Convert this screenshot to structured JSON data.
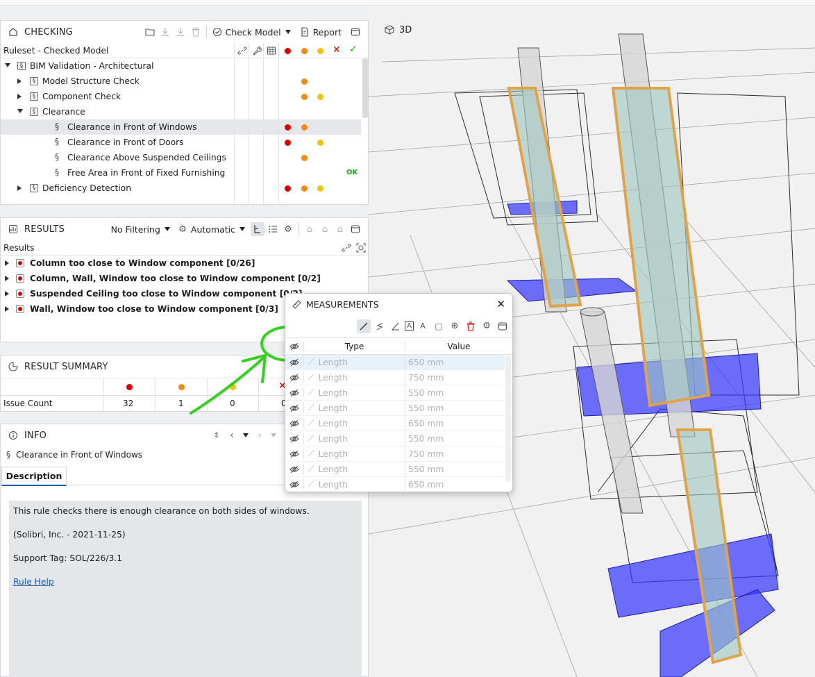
{
  "checking": {
    "title": "CHECKING",
    "check_model": "Check Model",
    "report": "Report",
    "column": "Ruleset - Checked Model",
    "rows": [
      {
        "label": "BIM Validation - Architectural",
        "level": 0,
        "expand": "open",
        "sym": "box",
        "dots": [],
        "ok": ""
      },
      {
        "label": "Model Structure Check",
        "level": 1,
        "expand": "closed",
        "sym": "box",
        "dots": [
          "org"
        ],
        "ok": ""
      },
      {
        "label": "Component Check",
        "level": 1,
        "expand": "closed",
        "sym": "box",
        "dots": [
          "org",
          "yel"
        ],
        "ok": ""
      },
      {
        "label": "Clearance",
        "level": 1,
        "expand": "open",
        "sym": "box",
        "dots": [],
        "ok": ""
      },
      {
        "label": "Clearance in Front of Windows",
        "level": 2,
        "expand": "",
        "sym": "§",
        "dots": [
          "red",
          "org"
        ],
        "ok": "",
        "selected": true
      },
      {
        "label": "Clearance in Front of Doors",
        "level": 2,
        "expand": "",
        "sym": "§",
        "dots": [
          "red",
          "yel"
        ],
        "ok": ""
      },
      {
        "label": "Clearance Above Suspended Ceilings",
        "level": 2,
        "expand": "",
        "sym": "§",
        "dots": [
          "org"
        ],
        "ok": ""
      },
      {
        "label": "Free Area in Front of Fixed Furnishing",
        "level": 2,
        "expand": "",
        "sym": "§",
        "dots": [],
        "ok": "OK"
      },
      {
        "label": "Deficiency Detection",
        "level": 1,
        "expand": "closed",
        "sym": "box",
        "dots": [
          "red",
          "org",
          "yel"
        ],
        "ok": ""
      }
    ]
  },
  "results": {
    "title": "RESULTS",
    "filter": "No Filtering",
    "mode": "Automatic",
    "column": "Results",
    "rows": [
      "Column too close to Window component [0/26]",
      "Column, Wall, Window too close to Window component [0/2]",
      "Suspended Ceiling too close to Window component [0/2]",
      "Wall, Window too close to Window component [0/3]"
    ]
  },
  "summary": {
    "title": "RESULT SUMMARY",
    "row_label": "Issue Count",
    "values": [
      "32",
      "1",
      "0",
      "0"
    ]
  },
  "info": {
    "title": "INFO",
    "rule": "Clearance in Front of Windows",
    "tab": "Description",
    "text": "This rule checks there is enough clearance on both sides of windows.",
    "author": "(Solibri, Inc. - 2021-11-25)",
    "support": "Support Tag: SOL/226/3.1",
    "help": "Rule Help"
  },
  "viewport": {
    "title": "3D"
  },
  "measurements": {
    "title": "MEASUREMENTS",
    "col_type": "Type",
    "col_value": "Value",
    "rows": [
      {
        "type": "Length",
        "value": "650 mm"
      },
      {
        "type": "Length",
        "value": "750 mm"
      },
      {
        "type": "Length",
        "value": "550 mm"
      },
      {
        "type": "Length",
        "value": "550 mm"
      },
      {
        "type": "Length",
        "value": "650 mm"
      },
      {
        "type": "Length",
        "value": "550 mm"
      },
      {
        "type": "Length",
        "value": "750 mm"
      },
      {
        "type": "Length",
        "value": "550 mm"
      },
      {
        "type": "Length",
        "value": "650 mm"
      }
    ]
  },
  "colors": {
    "error": "#d90000",
    "warning": "#ef8a12",
    "notice": "#f4c20d",
    "ok": "#20a020",
    "annotation": "#34d11f"
  }
}
